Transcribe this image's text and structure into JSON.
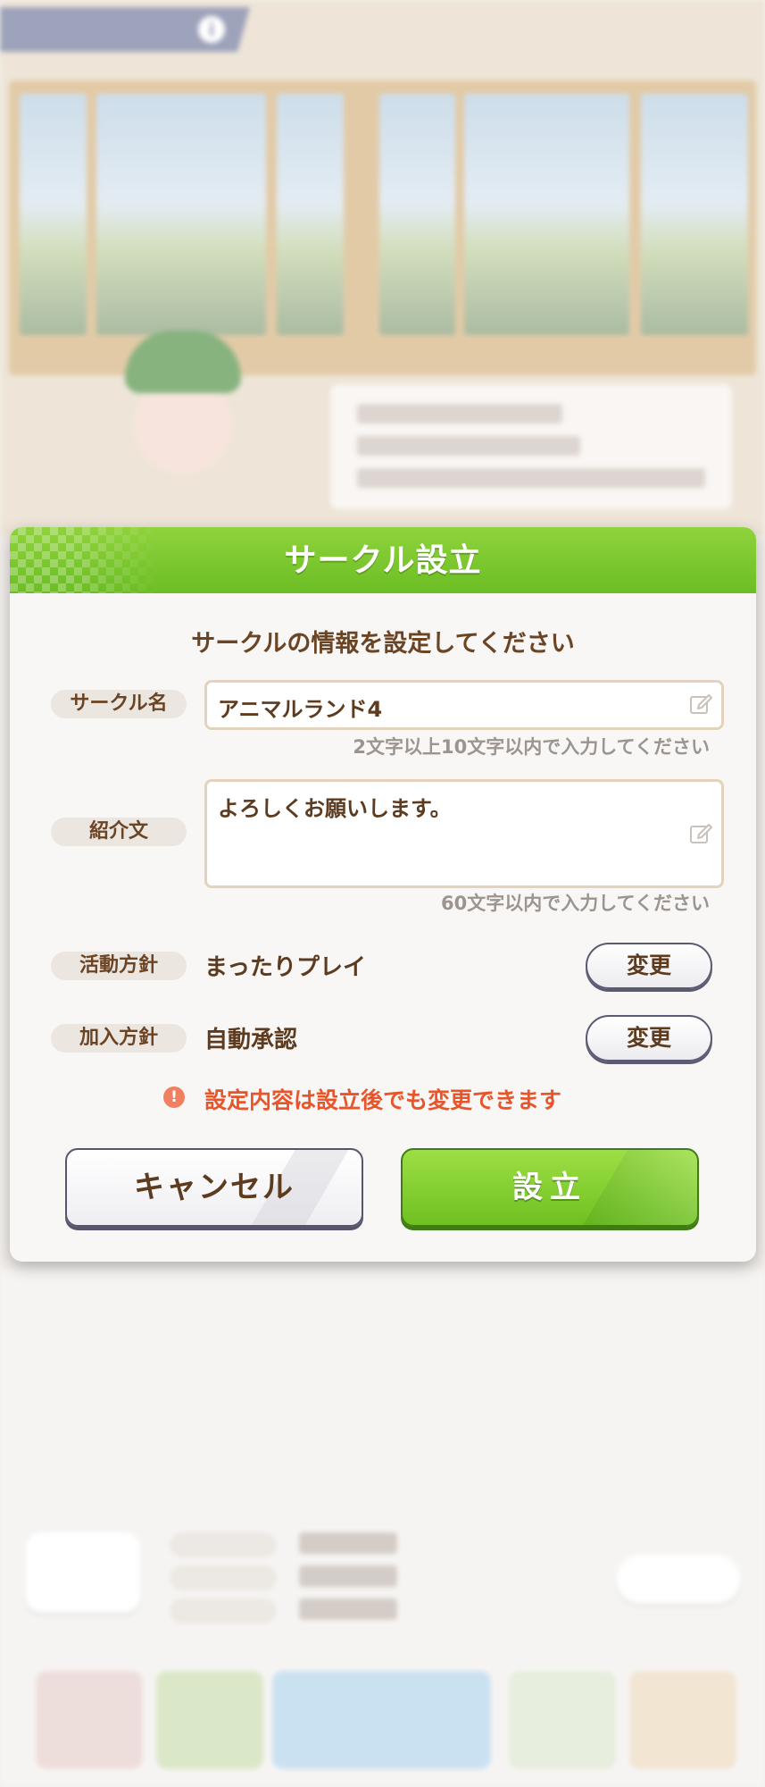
{
  "dialog": {
    "title": "サークル設立",
    "subtitle": "サークルの情報を設定してください",
    "name_field": {
      "label": "サークル名",
      "value": "アニマルランド4",
      "hint": "2文字以上10文字以内で入力してください"
    },
    "intro_field": {
      "label": "紹介文",
      "value": "よろしくお願いします。",
      "hint": "60文字以内で入力してください"
    },
    "activity_policy": {
      "label": "活動方針",
      "value": "まったりプレイ",
      "button": "変更"
    },
    "join_policy": {
      "label": "加入方針",
      "value": "自動承認",
      "button": "変更"
    },
    "notice": "設定内容は設立後でも変更できます",
    "cancel_button": "キャンセル",
    "confirm_button": "設立"
  },
  "icons": {
    "edit": "pencil-icon",
    "alert": "exclamation-circle-icon"
  },
  "colors": {
    "header_green": "#7cc72c",
    "text_brown": "#5d3b1f",
    "notice_red": "#e9552a",
    "field_border": "#e3d3bd"
  }
}
